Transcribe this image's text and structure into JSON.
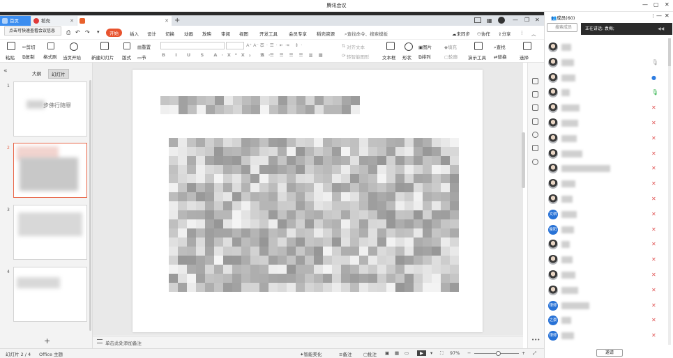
{
  "window": {
    "title": "腾讯会议",
    "controls": [
      "—",
      "▢",
      "✕"
    ]
  },
  "tabs": [
    {
      "label": "首页"
    },
    {
      "label": "稻壳"
    },
    {
      "label": ""
    }
  ],
  "tooltip": "点击可快速查看会议信息",
  "menu": {
    "items": [
      "开始",
      "插入",
      "设计",
      "切换",
      "动画",
      "放映",
      "审阅",
      "视图",
      "开发工具",
      "会员专享",
      "稻壳资源"
    ],
    "search": "查找命令、搜索模板",
    "right": [
      "未同步",
      "协作",
      "分享"
    ]
  },
  "ribbon": {
    "cut": "剪切",
    "copy": "复制",
    "paste": "粘贴",
    "format_painter": "格式刷",
    "play_from_current": "当页开始",
    "new_slide": "新建幻灯片",
    "layout": "版式",
    "section": "节",
    "reset": "重置",
    "format_text": "对齐文本",
    "convert_smartart": "转智能图形",
    "textbox": "文本框",
    "shape": "形状",
    "arrange": "排列",
    "picture": "图片",
    "fill": "填充",
    "outline": "轮廓",
    "presentation_tools": "演示工具",
    "find": "查找",
    "replace": "替换",
    "select": "选择"
  },
  "left_panel": {
    "tabs": [
      "大纲",
      "幻灯片"
    ],
    "slides": [
      {
        "num": "1",
        "text": "步佛行随罪"
      },
      {
        "num": "2",
        "text": ""
      },
      {
        "num": "3",
        "text": ""
      },
      {
        "num": "4",
        "text": ""
      }
    ]
  },
  "notes_placeholder": "单击此处添加备注",
  "status": {
    "slide": "幻灯片 2 / 4",
    "theme": "Office 主题",
    "beautify": "智能美化",
    "notes": "备注",
    "comments": "批注",
    "zoom": "97%"
  },
  "members": {
    "title": "成员(60)",
    "search_placeholder": "搜索成员",
    "speaking": "正在讲话: 袁梅;",
    "invite": "邀请",
    "list": [
      {
        "avatar": "",
        "type": "photo",
        "mic": "none"
      },
      {
        "avatar": "",
        "type": "photo",
        "mic": "gray"
      },
      {
        "avatar": "",
        "type": "photo",
        "mic": "blue"
      },
      {
        "avatar": "",
        "type": "photo",
        "mic": "green"
      },
      {
        "avatar": "",
        "type": "photo",
        "mic": "muted"
      },
      {
        "avatar": "",
        "type": "photo",
        "mic": "muted"
      },
      {
        "avatar": "",
        "type": "photo",
        "mic": "muted"
      },
      {
        "avatar": "",
        "type": "photo",
        "mic": "muted"
      },
      {
        "avatar": "",
        "type": "photo",
        "mic": "muted"
      },
      {
        "avatar": "",
        "type": "photo",
        "mic": "muted"
      },
      {
        "avatar": "",
        "type": "photo",
        "mic": "muted"
      },
      {
        "avatar": "文琪",
        "type": "txt",
        "mic": "muted"
      },
      {
        "avatar": "俊阳",
        "type": "txt",
        "mic": "muted"
      },
      {
        "avatar": "",
        "type": "photo",
        "mic": "muted"
      },
      {
        "avatar": "",
        "type": "photo",
        "mic": "muted"
      },
      {
        "avatar": "",
        "type": "photo",
        "mic": "muted"
      },
      {
        "avatar": "",
        "type": "photo",
        "mic": "muted"
      },
      {
        "avatar": "律师",
        "type": "txt",
        "mic": "muted"
      },
      {
        "avatar": "之豪",
        "type": "txt",
        "mic": "muted"
      },
      {
        "avatar": "律师",
        "type": "txt",
        "mic": "muted"
      }
    ]
  },
  "colors": {
    "accent": "#e8532e",
    "tab_active": "#3c8ef0",
    "muted_mic": "#e05252",
    "avatar_text_bg": "#2872d6"
  }
}
